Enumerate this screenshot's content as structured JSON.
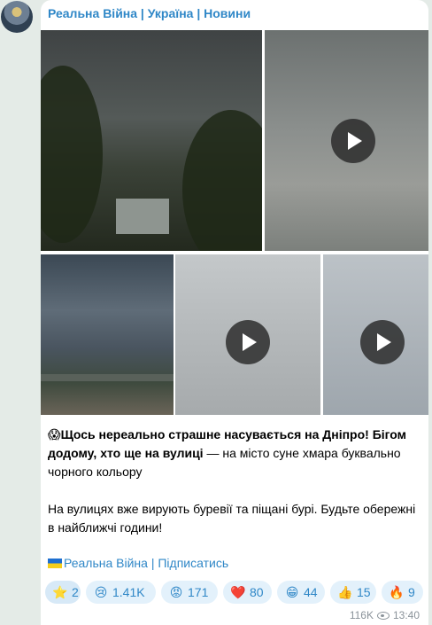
{
  "channel": {
    "name": "Реальна Війна | Україна | Новини"
  },
  "media": [
    {
      "kind": "photo"
    },
    {
      "kind": "video"
    },
    {
      "kind": "photo"
    },
    {
      "kind": "video"
    },
    {
      "kind": "video"
    }
  ],
  "message": {
    "emoji": "😱",
    "bold": "Щось нереально страшне насувається на Дніпро! Бігом додому, хто ще на вулиці",
    "rest": " — на місто суне хмара буквально чорного кольору",
    "para2": "На вулицях вже вирують буревії та піщані бурі. Будьте обережні в найближчі години!",
    "subscribe_flag": "🇺🇦",
    "subscribe_link": "Реальна Війна | Підписатись"
  },
  "reactions": [
    {
      "emoji": "⭐",
      "count": "2"
    },
    {
      "emoji": "😢",
      "count": "1.41K"
    },
    {
      "emoji": "😡",
      "count": "171"
    },
    {
      "emoji": "❤️",
      "count": "80"
    },
    {
      "emoji": "😁",
      "count": "44"
    },
    {
      "emoji": "👍",
      "count": "15"
    },
    {
      "emoji": "🔥",
      "count": "9"
    }
  ],
  "meta": {
    "views": "116K",
    "time": "13:40"
  },
  "colors": {
    "link": "#2f87c7",
    "chat_background": "#e4ebe7",
    "reaction_background": "#e3f1fb"
  }
}
